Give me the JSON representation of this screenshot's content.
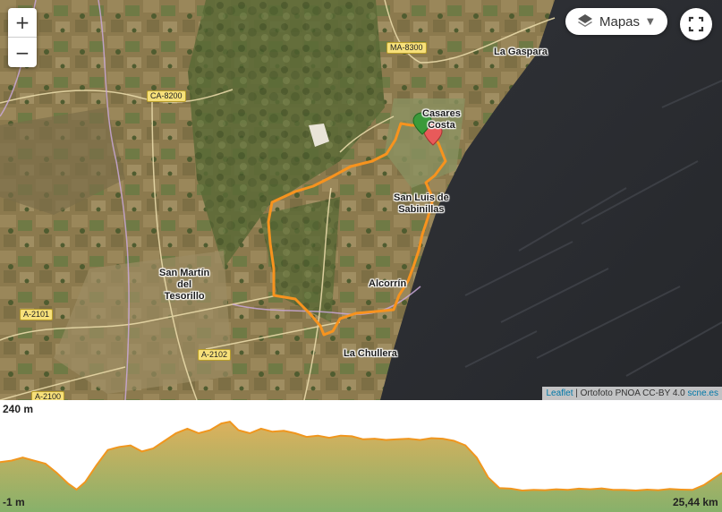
{
  "map": {
    "places": {
      "la_gaspara": "La Gaspara",
      "casares_costa": "Casares\nCosta",
      "san_luis": "San Luis de\nSabinillas",
      "san_martin": "San Martín\ndel\nTesorillo",
      "alcorrin": "Alcorrín",
      "la_chullera": "La Chullera"
    },
    "roads": {
      "ma8300": "MA-8300",
      "ca8200": "CA-8200",
      "a2101": "A-2101",
      "a2102": "A-2102",
      "a2100": "A-2100"
    },
    "controls": {
      "zoom_in": "+",
      "zoom_out": "−",
      "layers_label": "Mapas",
      "layers_icon": "layers-icon",
      "fullscreen_icon": "fullscreen-icon"
    },
    "attribution": {
      "leaflet": "Leaflet",
      "separator": " | ",
      "text": "Ortofoto PNOA CC-BY 4.0 ",
      "link": "scne.es"
    },
    "colors": {
      "route": "#f7931e",
      "sea": "#2a2c31",
      "start_marker": "#3a9a3a",
      "end_marker": "#e85a5a",
      "elevation_fill_top": "#d9a84a",
      "elevation_fill_bottom": "#7aa85a",
      "elevation_line": "#f0961e"
    }
  },
  "profile": {
    "max_label": "240 m",
    "min_label": "-1 m",
    "distance_label": "25,44 km",
    "elevation_m": [
      [
        0,
        95
      ],
      [
        0.4,
        100
      ],
      [
        0.8,
        110
      ],
      [
        1.2,
        100
      ],
      [
        1.6,
        90
      ],
      [
        2.0,
        60
      ],
      [
        2.4,
        25
      ],
      [
        2.7,
        5
      ],
      [
        3.0,
        30
      ],
      [
        3.4,
        85
      ],
      [
        3.8,
        135
      ],
      [
        4.2,
        145
      ],
      [
        4.6,
        150
      ],
      [
        5.0,
        130
      ],
      [
        5.4,
        140
      ],
      [
        5.8,
        165
      ],
      [
        6.2,
        190
      ],
      [
        6.6,
        205
      ],
      [
        7.0,
        190
      ],
      [
        7.4,
        200
      ],
      [
        7.8,
        222
      ],
      [
        8.1,
        228
      ],
      [
        8.4,
        200
      ],
      [
        8.8,
        190
      ],
      [
        9.2,
        205
      ],
      [
        9.6,
        195
      ],
      [
        10.0,
        198
      ],
      [
        10.4,
        190
      ],
      [
        10.8,
        178
      ],
      [
        11.2,
        182
      ],
      [
        11.6,
        175
      ],
      [
        12.0,
        182
      ],
      [
        12.4,
        180
      ],
      [
        12.8,
        170
      ],
      [
        13.2,
        172
      ],
      [
        13.6,
        168
      ],
      [
        14.0,
        170
      ],
      [
        14.4,
        172
      ],
      [
        14.8,
        168
      ],
      [
        15.2,
        174
      ],
      [
        15.6,
        172
      ],
      [
        16.0,
        165
      ],
      [
        16.4,
        150
      ],
      [
        16.8,
        110
      ],
      [
        17.2,
        45
      ],
      [
        17.6,
        10
      ],
      [
        18.0,
        8
      ],
      [
        18.4,
        2
      ],
      [
        18.8,
        4
      ],
      [
        19.2,
        3
      ],
      [
        19.6,
        6
      ],
      [
        20.0,
        4
      ],
      [
        20.4,
        8
      ],
      [
        20.8,
        6
      ],
      [
        21.2,
        9
      ],
      [
        21.6,
        4
      ],
      [
        22.0,
        4
      ],
      [
        22.4,
        2
      ],
      [
        22.8,
        5
      ],
      [
        23.2,
        3
      ],
      [
        23.6,
        7
      ],
      [
        24.0,
        5
      ],
      [
        24.4,
        4
      ],
      [
        24.8,
        20
      ],
      [
        25.44,
        60
      ]
    ],
    "y_range": [
      -1,
      240
    ],
    "x_range": [
      0,
      25.44
    ]
  }
}
